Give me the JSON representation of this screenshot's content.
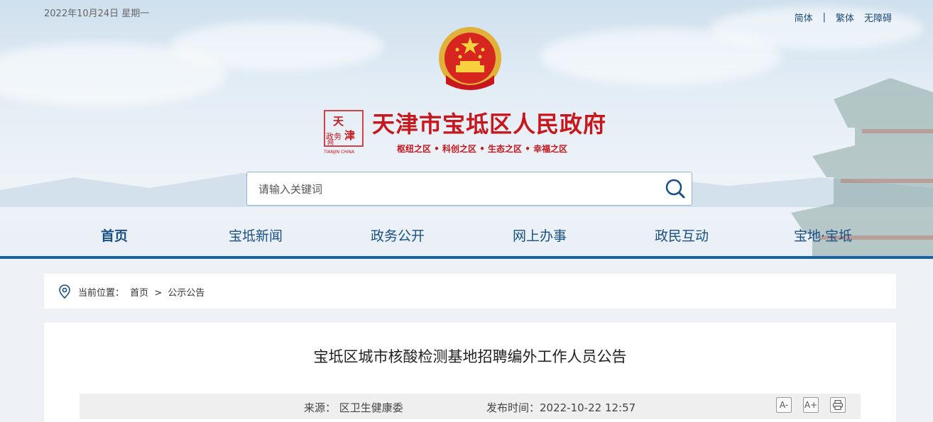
{
  "header": {
    "date": "2022年10月24日 星期一",
    "lang_links": [
      "简体",
      "繁体",
      "无障碍"
    ],
    "lang_sep": "|",
    "site_title": "天津市宝坻区人民政府",
    "slogan": "枢纽之区 • 科创之区 • 生态之区 • 幸福之区",
    "seal_text": [
      "天津",
      "政务",
      "网",
      "TIANJIN CHINA"
    ]
  },
  "search": {
    "placeholder": "请输入关键词",
    "icon": "search-icon"
  },
  "nav": {
    "items": [
      "首页",
      "宝坻新闻",
      "政务公开",
      "网上办事",
      "政民互动",
      "宝地·宝坻"
    ],
    "active": "首页"
  },
  "breadcrumb": {
    "label": "当前位置：",
    "home": "首页",
    "sep": ">",
    "current": "公示公告"
  },
  "article": {
    "title": "宝坻区城市核酸检测基地招聘编外工作人员公告",
    "source": "来源：  区卫生健康委",
    "time": "发布时间：2022-10-22 12:57",
    "tools": [
      "A-",
      "A+",
      "print-icon"
    ]
  },
  "colors": {
    "brand_red": "#c8161d",
    "nav_blue": "#1a4f85",
    "nav_line": "#1763a6"
  }
}
